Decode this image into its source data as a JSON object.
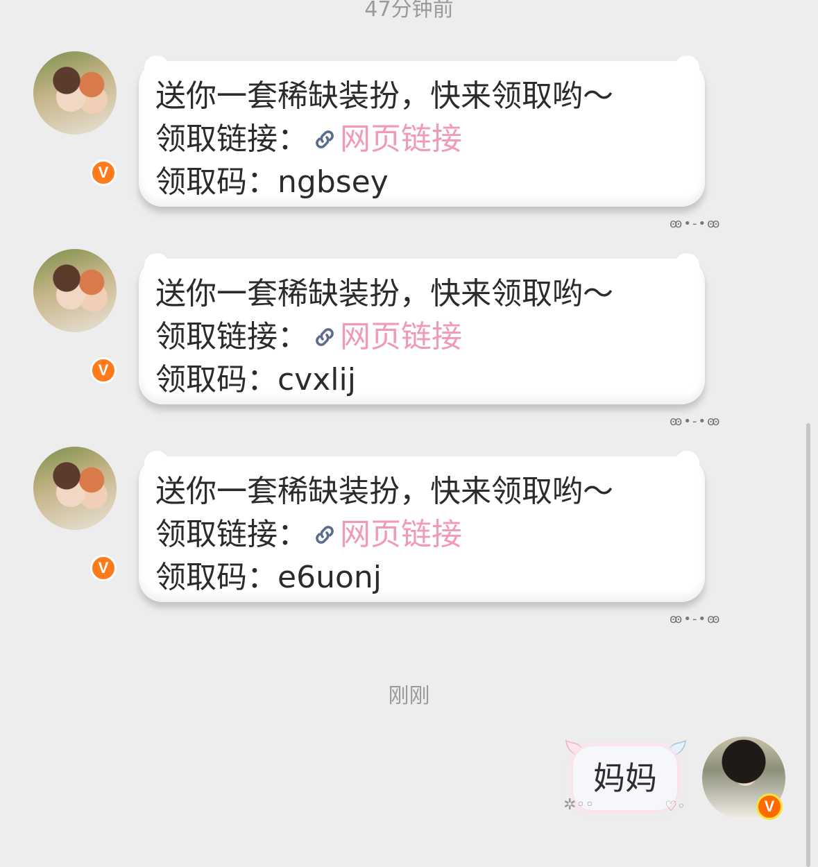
{
  "timestamps": {
    "top": "47分钟前",
    "now": "刚刚"
  },
  "messages": [
    {
      "line1": "送你一套稀缺装扮，快来领取哟～",
      "link_label": "领取链接：",
      "link_text": "网页链接",
      "code_label": "领取码：",
      "code": "ngbsey"
    },
    {
      "line1": "送你一套稀缺装扮，快来领取哟～",
      "link_label": "领取链接：",
      "link_text": "网页链接",
      "code_label": "领取码：",
      "code": "cvxlij"
    },
    {
      "line1": "送你一套稀缺装扮，快来领取哟～",
      "link_label": "领取链接：",
      "link_text": "网页链接",
      "code_label": "领取码：",
      "code": "e6uonj"
    }
  ],
  "my_message": {
    "text": "妈妈"
  },
  "badge_letter": "V",
  "icons": {
    "link": "chain-link-icon",
    "verified": "verified-badge-icon"
  },
  "colors": {
    "link": "#f09ab8",
    "badge": "#ff7a1a",
    "background": "#ededed"
  }
}
